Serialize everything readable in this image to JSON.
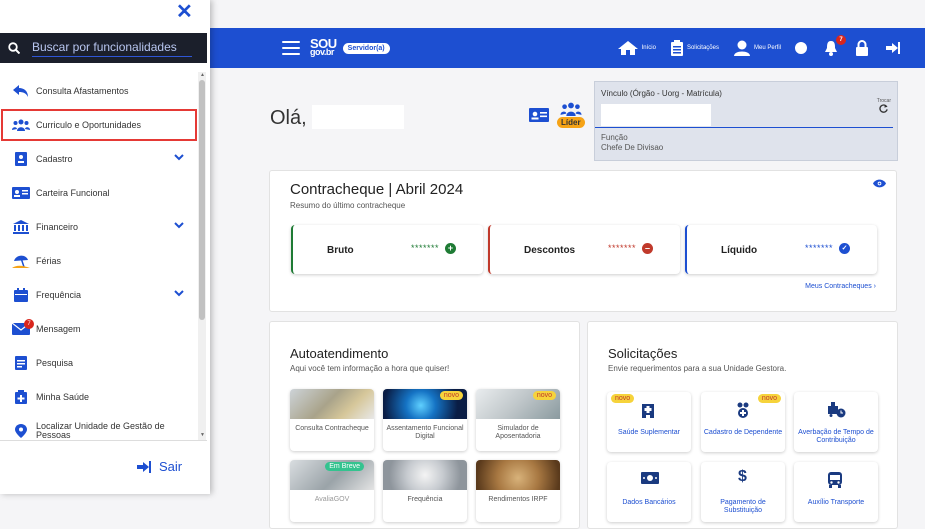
{
  "sidebar": {
    "search_placeholder": "Buscar por funcionalidades",
    "items": [
      {
        "label": "Consulta Afastamentos",
        "icon": "reply-arrow-icon"
      },
      {
        "label": "Curriculo e Oportunidades",
        "icon": "users-group-icon"
      },
      {
        "label": "Cadastro",
        "icon": "id-badge-icon"
      },
      {
        "label": "Carteira Funcional",
        "icon": "id-card-icon"
      },
      {
        "label": "Financeiro",
        "icon": "bank-icon"
      },
      {
        "label": "Férias",
        "icon": "beach-umbrella-icon"
      },
      {
        "label": "Frequência",
        "icon": "calendar-icon"
      },
      {
        "label": "Mensagem",
        "icon": "envelope-icon",
        "badge": "7"
      },
      {
        "label": "Pesquisa",
        "icon": "survey-icon"
      },
      {
        "label": "Minha Saúde",
        "icon": "medical-kit-icon"
      },
      {
        "label": "Localizar Unidade de Gestão de Pessoas",
        "icon": "map-pin-icon"
      }
    ],
    "logout_label": "Sair"
  },
  "topbar": {
    "logo_line1": "SOU",
    "logo_line2": "gov.br",
    "role_badge": "Servidor(a)",
    "actions": [
      {
        "label": "Início",
        "icon": "home-icon"
      },
      {
        "label": "Solicitações",
        "icon": "clipboard-icon"
      },
      {
        "label": "Meu Perfil",
        "icon": "user-icon"
      }
    ],
    "notifications_count": "7"
  },
  "main": {
    "greeting": "Olá,",
    "lider_label": "Líder",
    "vinculo": {
      "label": "Vínculo (Órgão - Uorg - Matrícula)",
      "trocar": "Trocar",
      "funcao_label": "Função",
      "funcao_value": "Chefe De Divisao"
    },
    "contracheque": {
      "title": "Contracheque | Abril 2024",
      "subtitle": "Resumo do último contracheque",
      "boxes": [
        {
          "label": "Bruto",
          "masked": "*******",
          "color": "#1e7b34"
        },
        {
          "label": "Descontos",
          "masked": "*******",
          "color": "#c0392b"
        },
        {
          "label": "Líquido",
          "masked": "*******",
          "color": "#1d4fd1"
        }
      ],
      "link": "Meus Contracheques"
    },
    "autoatendimento": {
      "title": "Autoatendimento",
      "subtitle": "Aqui você tem informação a hora que quiser!",
      "tiles": [
        {
          "label": "Consulta Contracheque",
          "tag": ""
        },
        {
          "label": "Assentamento Funcional Digital",
          "tag": "novo"
        },
        {
          "label": "Simulador de Aposentadoria",
          "tag": "novo"
        },
        {
          "label": "AvaliaGOV",
          "tag": "Em Breve"
        },
        {
          "label": "Frequência",
          "tag": ""
        },
        {
          "label": "Rendimentos IRPF",
          "tag": ""
        }
      ]
    },
    "solicitacoes": {
      "title": "Solicitações",
      "subtitle": "Envie requerimentos para a sua Unidade Gestora.",
      "tiles": [
        {
          "label": "Saúde Suplementar",
          "tag": "novo",
          "icon": "hospital-icon"
        },
        {
          "label": "Cadastro de Dependente",
          "tag": "novo",
          "icon": "dependent-medical-icon"
        },
        {
          "label": "Averbação de Tempo de Contribuição",
          "tag": "",
          "icon": "truck-clock-icon"
        },
        {
          "label": "Dados Bancários",
          "tag": "",
          "icon": "money-bill-icon"
        },
        {
          "label": "Pagamento de Substituição",
          "tag": "",
          "icon": "dollar-icon"
        },
        {
          "label": "Auxílio Transporte",
          "tag": "",
          "icon": "bus-icon"
        }
      ]
    }
  },
  "colors": {
    "brand": "#1d4fd1",
    "accent": "#f6a316",
    "highlight": "#e53935"
  }
}
